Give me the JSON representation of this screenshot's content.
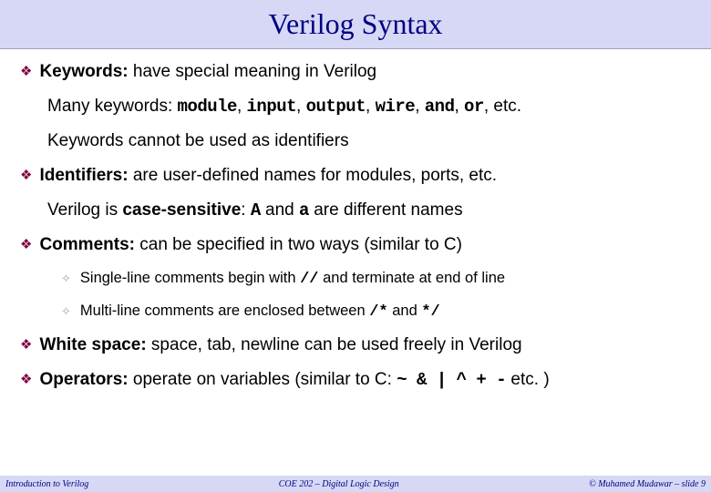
{
  "title": "Verilog Syntax",
  "bullets": {
    "keywords": {
      "label": "Keywords:",
      "text": " have special meaning in Verilog",
      "line_many_prefix": "Many keywords: ",
      "kw_module": "module",
      "kw_input": "input",
      "kw_output": "output",
      "kw_wire": "wire",
      "kw_and": "and",
      "kw_or": "or",
      "line_many_suffix": ", etc.",
      "line_noid": "Keywords cannot be used as identifiers"
    },
    "identifiers": {
      "label": "Identifiers:",
      "text": " are user-defined names for modules, ports, etc.",
      "case_prefix": "Verilog is ",
      "case_sens": "case-sensitive",
      "case_colon": ": ",
      "example_A": "A",
      "case_mid": " and ",
      "example_a": "a",
      "case_suffix": " are different names"
    },
    "comments": {
      "label": "Comments:",
      "text": " can be specified in two ways (similar to C)",
      "single_prefix": "Single-line comments begin with ",
      "single_token": "//",
      "single_suffix": " and terminate at end of line",
      "multi_prefix": "Multi-line comments are enclosed between ",
      "multi_open": "/*",
      "multi_mid": " and ",
      "multi_close": "*/"
    },
    "whitespace": {
      "label": "White space:",
      "text": " space, tab, newline can be used freely in Verilog"
    },
    "operators": {
      "label": "Operators:",
      "text_prefix": " operate on variables (similar to C: ",
      "ops": "~ & | ^ + -",
      "text_suffix": " etc. )"
    }
  },
  "footer": {
    "left": "Introduction to Verilog",
    "center": "COE 202 – Digital Logic Design",
    "right": "© Muhamed Mudawar – slide 9"
  },
  "sep": ", "
}
